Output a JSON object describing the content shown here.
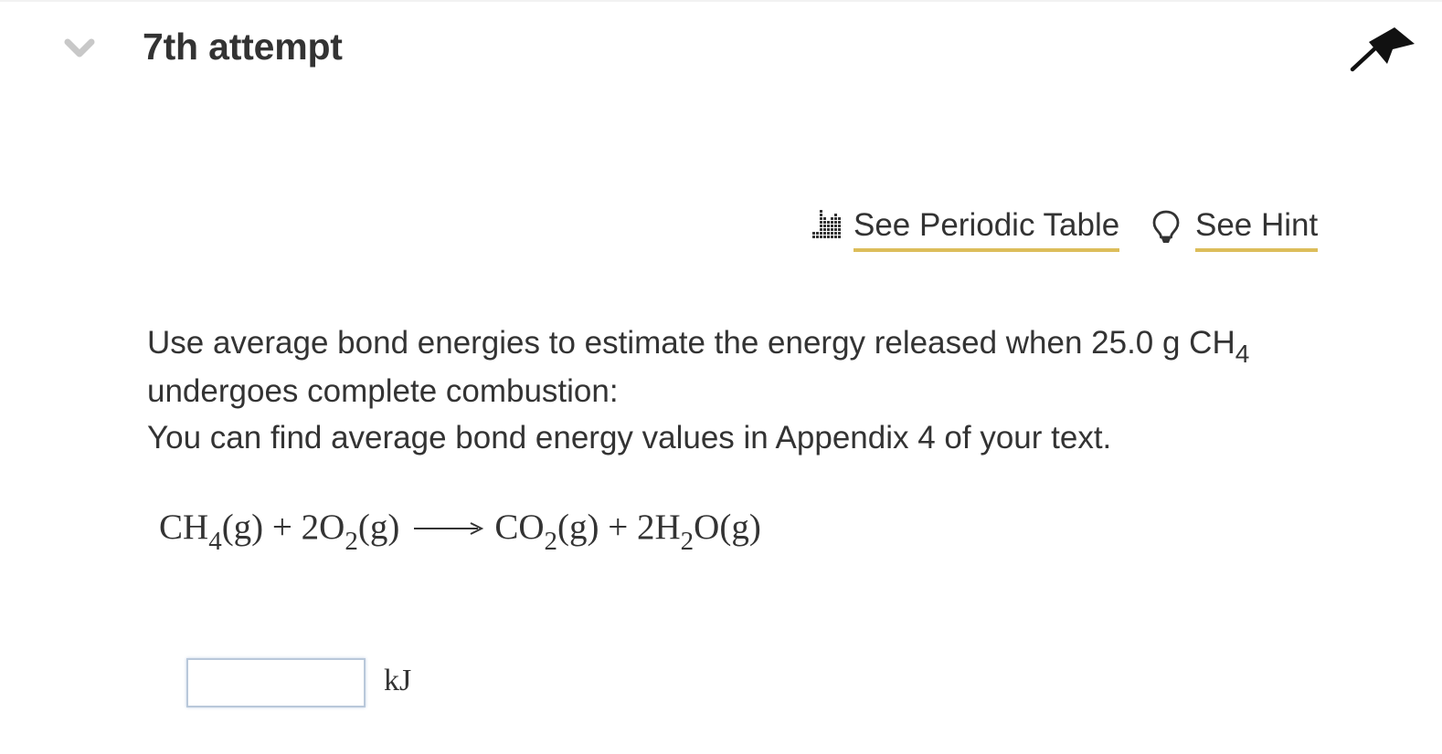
{
  "header": {
    "title": "7th attempt"
  },
  "links": {
    "periodic_table": "See Periodic Table",
    "hint": "See Hint"
  },
  "question": {
    "line1_prefix": "Use average bond energies to estimate the energy released when 25.0 g CH",
    "line1_sub": "4",
    "line2": "undergoes complete combustion:",
    "line3": "You can find average bond energy values in Appendix 4 of your text."
  },
  "equation": {
    "r1": "CH",
    "r1_sub": "4",
    "r1_state": "(g)",
    "plus1": " + ",
    "r2": "2O",
    "r2_sub": "2",
    "r2_state": "(g)",
    "p1": "CO",
    "p1_sub": "2",
    "p1_state": "(g)",
    "plus2": " + ",
    "p2a": "2H",
    "p2_sub": "2",
    "p2b": "O",
    "p2_state": "(g)"
  },
  "answer": {
    "value": "",
    "unit": "kJ"
  },
  "colors": {
    "link_underline": "#dcbd5a",
    "text": "#333333",
    "chevron": "#c8c8c8"
  },
  "icons": {
    "collapse": "chevron-down-icon",
    "pin": "pin-icon",
    "periodic_table": "periodic-table-icon",
    "hint": "lightbulb-icon"
  }
}
